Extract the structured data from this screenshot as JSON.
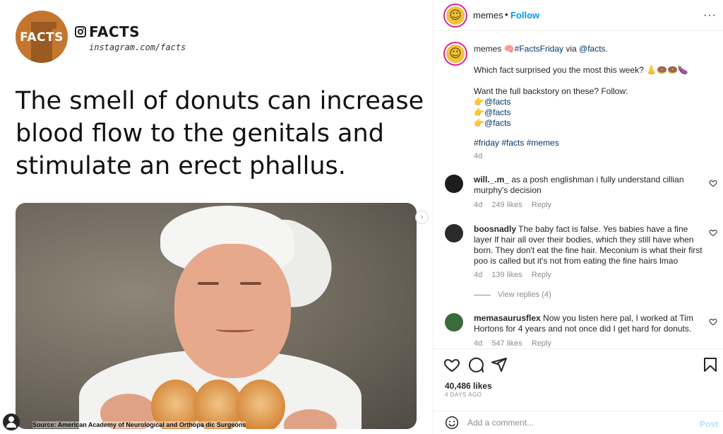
{
  "media": {
    "logo_text": "FACTS",
    "brand_name": "FACTS",
    "brand_url": "instagram.com/facts",
    "headline_lines": [
      "The smell of donuts can increase",
      "blood flow to the genitals and",
      "stimulate an erect phallus."
    ],
    "photo_source": "Source: American Academy of Neurological and Orthopa dic Surgeons",
    "carousel_next": "›"
  },
  "header": {
    "username": "memes",
    "separator": "•",
    "follow_label": "Follow",
    "more_label": "···"
  },
  "caption": {
    "username": "memes",
    "line1_emoji": "🧠",
    "line1_hashtag": "#FactsFriday",
    "line1_via": " via ",
    "line1_mention": "@facts",
    "line1_end": ".",
    "line2": "Which fact surprised you the most this week? 👃🍩🍩🍆",
    "line3": "Want the full backstory on these? Follow:",
    "follows": [
      {
        "emoji": "👉",
        "mention": "@facts"
      },
      {
        "emoji": "👉",
        "mention": "@facts"
      },
      {
        "emoji": "👉",
        "mention": "@facts"
      }
    ],
    "hashtags": "#friday #facts #memes",
    "time": "4d"
  },
  "comments": [
    {
      "username": "will._.m_",
      "text": " as a posh englishman i fully understand cillian murphy's decision",
      "time": "4d",
      "likes": "249 likes",
      "reply": "Reply"
    },
    {
      "username": "boosnadly",
      "text": " The baby fact is false. Yes babies have a fine layer lf hair all over their bodies, which they still have when born. They don't eat the fine hair. Meconium is what their first poo is called but it's not from eating the fine hairs lmao",
      "time": "4d",
      "likes": "139 likes",
      "reply": "Reply",
      "view_replies": "View replies (4)"
    },
    {
      "username": "memasaurusflex",
      "text": " Now you listen here pal, I worked at Tim Hortons for 4 years and not once did I get hard for donuts.",
      "time": "4d",
      "likes": "547 likes",
      "reply": "Reply"
    }
  ],
  "footer": {
    "likes": "40,486 likes",
    "ago": "4 DAYS AGO",
    "comment_placeholder": "Add a comment...",
    "post_label": "Post"
  },
  "colors": {
    "follow_blue": "#0095f6",
    "link_navy": "#00376b",
    "muted_gray": "#8e8e8e",
    "facts_orange": "#c4762f"
  },
  "icons": [
    "instagram-icon",
    "more-icon",
    "heart-icon",
    "comment-icon",
    "share-icon",
    "bookmark-icon",
    "emoji-icon",
    "chevron-right-icon"
  ]
}
